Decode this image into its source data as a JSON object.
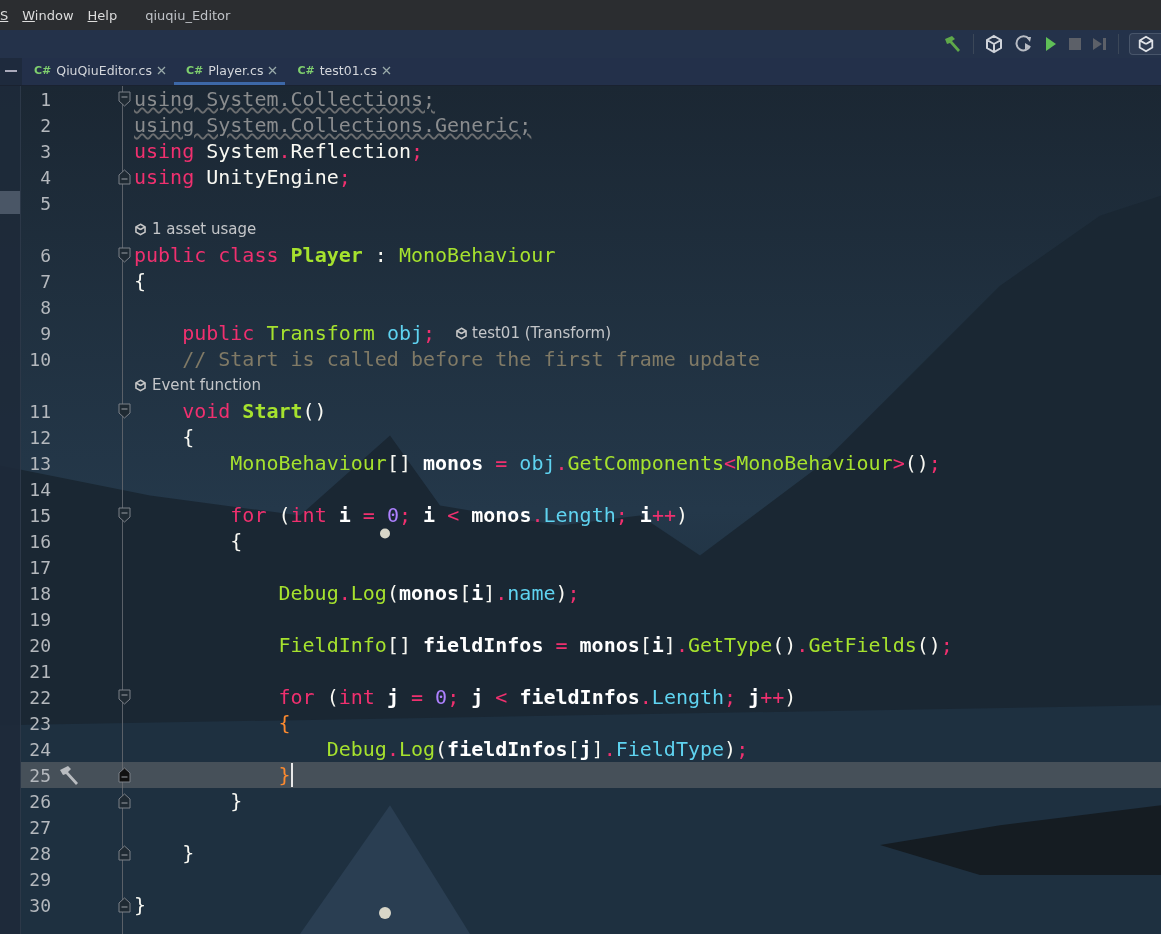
{
  "menu": [
    "S",
    "Window",
    "Help"
  ],
  "window": {
    "title": "qiuqiu_Editor"
  },
  "tabs": [
    {
      "badge": "C#",
      "label": "QiuQiuEditor.cs",
      "selected": false
    },
    {
      "badge": "C#",
      "label": "Player.cs",
      "selected": true
    },
    {
      "badge": "C#",
      "label": "test01.cs",
      "selected": false
    }
  ],
  "editor": {
    "rows": [
      {
        "kind": "line",
        "number": "1",
        "fold_start": true,
        "fold_end": false,
        "current": false,
        "tokens": [
          {
            "text": "using System.Collections;",
            "kind": "unused"
          }
        ]
      },
      {
        "kind": "line",
        "number": "2",
        "fold_start": false,
        "fold_end": false,
        "current": false,
        "tokens": [
          {
            "text": "using System.Collections.Generic;",
            "kind": "unused"
          }
        ]
      },
      {
        "kind": "line",
        "number": "3",
        "fold_start": false,
        "fold_end": false,
        "current": false,
        "tokens": [
          {
            "text": "using",
            "kind": "kw"
          },
          {
            "text": " System",
            "kind": "plain"
          },
          {
            "text": ".",
            "kind": "op"
          },
          {
            "text": "Reflection",
            "kind": "plain"
          },
          {
            "text": ";",
            "kind": "op"
          }
        ]
      },
      {
        "kind": "line",
        "number": "4",
        "fold_start": false,
        "fold_end": true,
        "current": false,
        "tokens": [
          {
            "text": "using",
            "kind": "kw"
          },
          {
            "text": " UnityEngine",
            "kind": "plain"
          },
          {
            "text": ";",
            "kind": "op"
          }
        ]
      },
      {
        "kind": "line",
        "number": "5",
        "fold_start": false,
        "fold_end": false,
        "current": false,
        "tokens": []
      },
      {
        "kind": "hint",
        "text": "1 asset usage"
      },
      {
        "kind": "line",
        "number": "6",
        "fold_start": true,
        "fold_end": false,
        "current": false,
        "tokens": [
          {
            "text": "public class ",
            "kind": "kw"
          },
          {
            "text": "Player",
            "kind": "decl"
          },
          {
            "text": " : ",
            "kind": "plain"
          },
          {
            "text": "MonoBehaviour",
            "kind": "type"
          }
        ]
      },
      {
        "kind": "line",
        "number": "7",
        "fold_start": false,
        "fold_end": false,
        "current": false,
        "tokens": [
          {
            "text": "{",
            "kind": "plain"
          }
        ]
      },
      {
        "kind": "line",
        "number": "8",
        "fold_start": false,
        "fold_end": false,
        "current": false,
        "tokens": []
      },
      {
        "kind": "line",
        "number": "9",
        "fold_start": false,
        "fold_end": false,
        "current": false,
        "inlay": "test01 (Transform)",
        "tokens": [
          {
            "text": "    public",
            "kind": "kw"
          },
          {
            "text": " Transform",
            "kind": "type"
          },
          {
            "text": " obj",
            "kind": "field"
          },
          {
            "text": ";",
            "kind": "op"
          }
        ]
      },
      {
        "kind": "line",
        "number": "10",
        "fold_start": false,
        "fold_end": false,
        "current": false,
        "tokens": [
          {
            "text": "    // Start is called before the first frame update",
            "kind": "comment"
          }
        ]
      },
      {
        "kind": "hint",
        "text": "Event function"
      },
      {
        "kind": "line",
        "number": "11",
        "fold_start": true,
        "fold_end": false,
        "current": false,
        "tokens": [
          {
            "text": "    void",
            "kind": "kw"
          },
          {
            "text": " Start",
            "kind": "decl"
          },
          {
            "text": "()",
            "kind": "plain"
          }
        ]
      },
      {
        "kind": "line",
        "number": "12",
        "fold_start": false,
        "fold_end": false,
        "current": false,
        "tokens": [
          {
            "text": "    {",
            "kind": "plain"
          }
        ]
      },
      {
        "kind": "line",
        "number": "13",
        "fold_start": false,
        "fold_end": false,
        "current": false,
        "tokens": [
          {
            "text": "        MonoBehaviour",
            "kind": "type"
          },
          {
            "text": "[]",
            "kind": "plain"
          },
          {
            "text": " monos",
            "kind": "ident"
          },
          {
            "text": " =",
            "kind": "op"
          },
          {
            "text": " obj",
            "kind": "field"
          },
          {
            "text": ".",
            "kind": "op"
          },
          {
            "text": "GetComponents",
            "kind": "type"
          },
          {
            "text": "<",
            "kind": "op"
          },
          {
            "text": "MonoBehaviour",
            "kind": "type"
          },
          {
            "text": ">",
            "kind": "op"
          },
          {
            "text": "()",
            "kind": "plain"
          },
          {
            "text": ";",
            "kind": "op"
          }
        ]
      },
      {
        "kind": "line",
        "number": "14",
        "fold_start": false,
        "fold_end": false,
        "current": false,
        "tokens": []
      },
      {
        "kind": "line",
        "number": "15",
        "fold_start": true,
        "fold_end": false,
        "current": false,
        "tokens": [
          {
            "text": "        for",
            "kind": "kw"
          },
          {
            "text": " (",
            "kind": "plain"
          },
          {
            "text": "int",
            "kind": "kw"
          },
          {
            "text": " i",
            "kind": "ident"
          },
          {
            "text": " =",
            "kind": "op"
          },
          {
            "text": " 0",
            "kind": "num"
          },
          {
            "text": ";",
            "kind": "op"
          },
          {
            "text": " i",
            "kind": "ident"
          },
          {
            "text": " <",
            "kind": "op"
          },
          {
            "text": " monos",
            "kind": "ident"
          },
          {
            "text": ".",
            "kind": "op"
          },
          {
            "text": "Length",
            "kind": "field"
          },
          {
            "text": ";",
            "kind": "op"
          },
          {
            "text": " i",
            "kind": "ident"
          },
          {
            "text": "++",
            "kind": "op"
          },
          {
            "text": ")",
            "kind": "plain"
          }
        ]
      },
      {
        "kind": "line",
        "number": "16",
        "fold_start": false,
        "fold_end": false,
        "current": false,
        "tokens": [
          {
            "text": "        {",
            "kind": "plain"
          }
        ]
      },
      {
        "kind": "line",
        "number": "17",
        "fold_start": false,
        "fold_end": false,
        "current": false,
        "tokens": []
      },
      {
        "kind": "line",
        "number": "18",
        "fold_start": false,
        "fold_end": false,
        "current": false,
        "tokens": [
          {
            "text": "            Debug",
            "kind": "type"
          },
          {
            "text": ".",
            "kind": "op"
          },
          {
            "text": "Log",
            "kind": "type"
          },
          {
            "text": "(",
            "kind": "plain"
          },
          {
            "text": "monos",
            "kind": "ident"
          },
          {
            "text": "[",
            "kind": "plain"
          },
          {
            "text": "i",
            "kind": "ident"
          },
          {
            "text": "]",
            "kind": "plain"
          },
          {
            "text": ".",
            "kind": "op"
          },
          {
            "text": "name",
            "kind": "field"
          },
          {
            "text": ")",
            "kind": "plain"
          },
          {
            "text": ";",
            "kind": "op"
          }
        ]
      },
      {
        "kind": "line",
        "number": "19",
        "fold_start": false,
        "fold_end": false,
        "current": false,
        "tokens": []
      },
      {
        "kind": "line",
        "number": "20",
        "fold_start": false,
        "fold_end": false,
        "current": false,
        "tokens": [
          {
            "text": "            FieldInfo",
            "kind": "type"
          },
          {
            "text": "[]",
            "kind": "plain"
          },
          {
            "text": " fieldInfos",
            "kind": "ident"
          },
          {
            "text": " =",
            "kind": "op"
          },
          {
            "text": " monos",
            "kind": "ident"
          },
          {
            "text": "[",
            "kind": "plain"
          },
          {
            "text": "i",
            "kind": "ident"
          },
          {
            "text": "]",
            "kind": "plain"
          },
          {
            "text": ".",
            "kind": "op"
          },
          {
            "text": "GetType",
            "kind": "type"
          },
          {
            "text": "()",
            "kind": "plain"
          },
          {
            "text": ".",
            "kind": "op"
          },
          {
            "text": "GetFields",
            "kind": "type"
          },
          {
            "text": "()",
            "kind": "plain"
          },
          {
            "text": ";",
            "kind": "op"
          }
        ]
      },
      {
        "kind": "line",
        "number": "21",
        "fold_start": false,
        "fold_end": false,
        "current": false,
        "tokens": []
      },
      {
        "kind": "line",
        "number": "22",
        "fold_start": true,
        "fold_end": false,
        "current": false,
        "tokens": [
          {
            "text": "            for",
            "kind": "kw"
          },
          {
            "text": " (",
            "kind": "plain"
          },
          {
            "text": "int",
            "kind": "kw"
          },
          {
            "text": " j",
            "kind": "ident"
          },
          {
            "text": " =",
            "kind": "op"
          },
          {
            "text": " 0",
            "kind": "num"
          },
          {
            "text": ";",
            "kind": "op"
          },
          {
            "text": " j",
            "kind": "ident"
          },
          {
            "text": " <",
            "kind": "op"
          },
          {
            "text": " fieldInfos",
            "kind": "ident"
          },
          {
            "text": ".",
            "kind": "op"
          },
          {
            "text": "Length",
            "kind": "field"
          },
          {
            "text": ";",
            "kind": "op"
          },
          {
            "text": " j",
            "kind": "ident"
          },
          {
            "text": "++",
            "kind": "op"
          },
          {
            "text": ")",
            "kind": "plain"
          }
        ]
      },
      {
        "kind": "line",
        "number": "23",
        "fold_start": false,
        "fold_end": false,
        "current": false,
        "tokens": [
          {
            "text": "            {",
            "kind": "brace"
          }
        ]
      },
      {
        "kind": "line",
        "number": "24",
        "fold_start": false,
        "fold_end": false,
        "current": false,
        "tokens": [
          {
            "text": "                Debug",
            "kind": "type"
          },
          {
            "text": ".",
            "kind": "op"
          },
          {
            "text": "Log",
            "kind": "type"
          },
          {
            "text": "(",
            "kind": "plain"
          },
          {
            "text": "fieldInfos",
            "kind": "ident"
          },
          {
            "text": "[",
            "kind": "plain"
          },
          {
            "text": "j",
            "kind": "ident"
          },
          {
            "text": "]",
            "kind": "plain"
          },
          {
            "text": ".",
            "kind": "op"
          },
          {
            "text": "FieldType",
            "kind": "field"
          },
          {
            "text": ")",
            "kind": "plain"
          },
          {
            "text": ";",
            "kind": "op"
          }
        ]
      },
      {
        "kind": "line",
        "number": "25",
        "fold_start": false,
        "fold_end": true,
        "current": true,
        "tokens": [
          {
            "text": "            }",
            "kind": "brace"
          }
        ]
      },
      {
        "kind": "line",
        "number": "26",
        "fold_start": false,
        "fold_end": true,
        "current": false,
        "tokens": [
          {
            "text": "        }",
            "kind": "plain"
          }
        ]
      },
      {
        "kind": "line",
        "number": "27",
        "fold_start": false,
        "fold_end": false,
        "current": false,
        "tokens": []
      },
      {
        "kind": "line",
        "number": "28",
        "fold_start": false,
        "fold_end": true,
        "current": false,
        "tokens": [
          {
            "text": "    }",
            "kind": "plain"
          }
        ]
      },
      {
        "kind": "line",
        "number": "29",
        "fold_start": false,
        "fold_end": false,
        "current": false,
        "tokens": []
      },
      {
        "kind": "line",
        "number": "30",
        "fold_start": false,
        "fold_end": true,
        "current": false,
        "tokens": [
          {
            "text": "}",
            "kind": "plain"
          }
        ]
      }
    ]
  }
}
